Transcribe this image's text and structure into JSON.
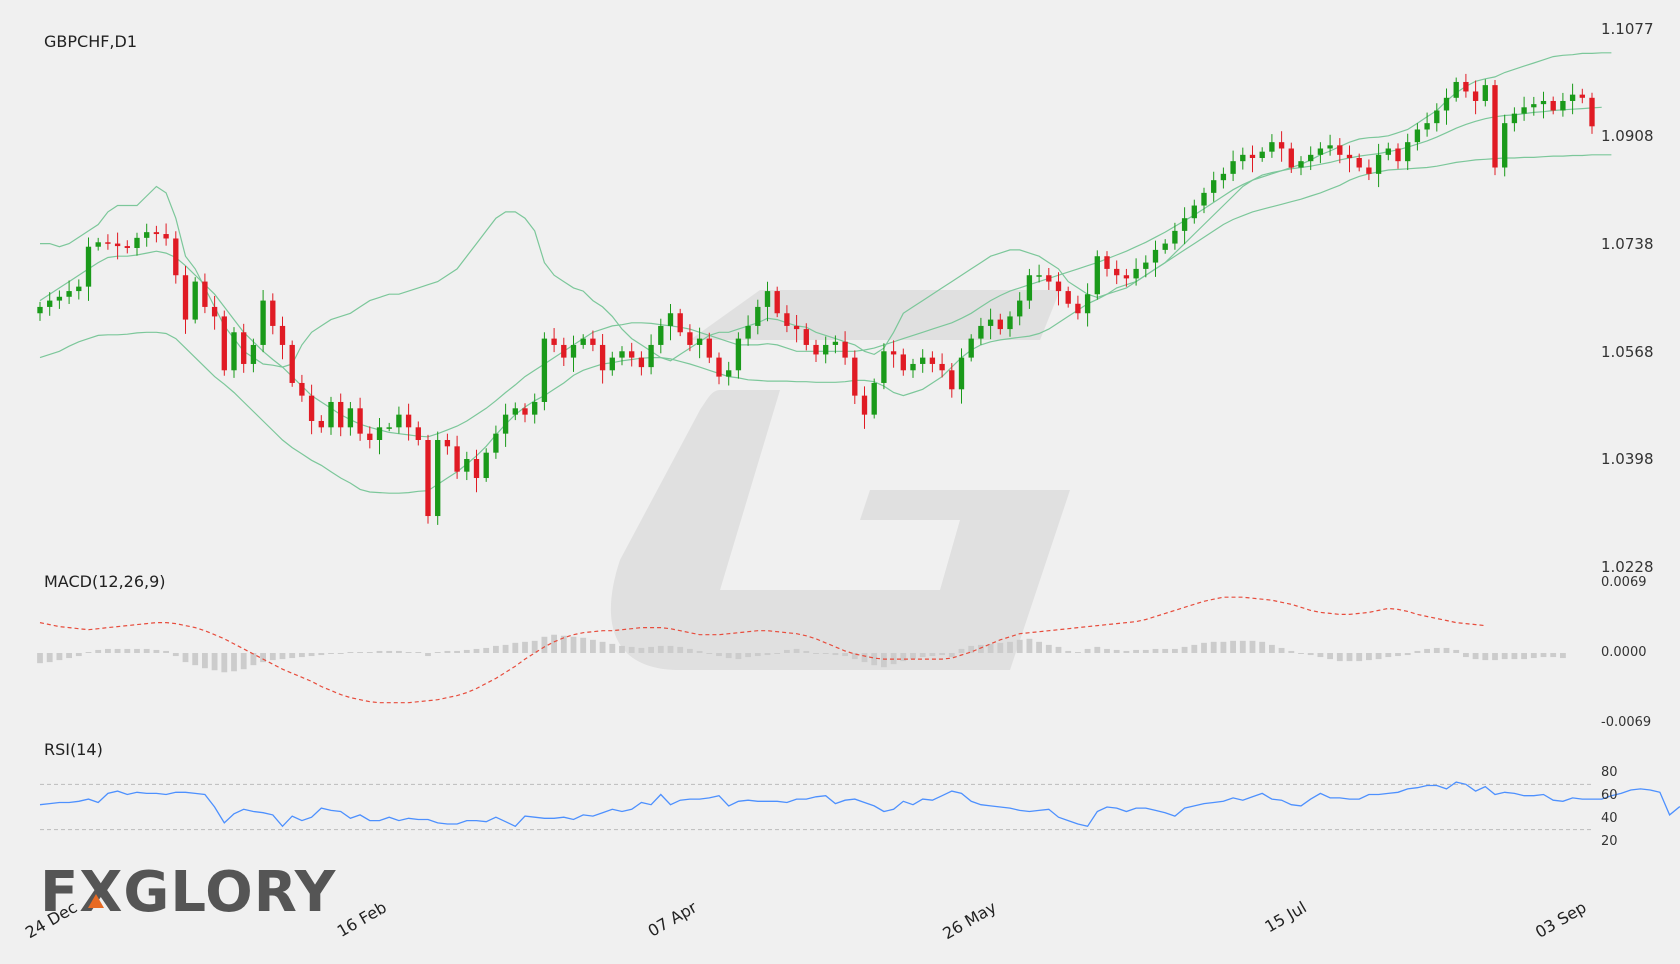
{
  "chart_data": [
    {
      "type": "candlestick",
      "title": "GBPCHF,D1",
      "symbol": "GBPCHF",
      "timeframe": "D1",
      "x_tick_labels": [
        "24 Dec",
        "16 Feb",
        "07 Apr",
        "26 May",
        "15 Jul",
        "03 Sep"
      ],
      "y_tick_labels": [
        "1.1077",
        "1.0908",
        "1.0738",
        "1.0568",
        "1.0398",
        "1.0228"
      ],
      "ylim": [
        1.0228,
        1.1077
      ],
      "overlays": [
        "Bollinger Bands"
      ],
      "up_color": "#1a9a1a",
      "down_color": "#e01b24",
      "band_color": "#7cc79a",
      "close": [
        1.064,
        1.065,
        1.0656,
        1.0665,
        1.0672,
        1.0735,
        1.0742,
        1.074,
        1.0736,
        1.0733,
        1.0749,
        1.0758,
        1.0755,
        1.0748,
        1.069,
        1.062,
        1.068,
        1.064,
        1.0625,
        1.054,
        1.06,
        1.055,
        1.058,
        1.065,
        1.061,
        1.058,
        1.052,
        1.05,
        1.046,
        1.045,
        1.049,
        1.045,
        1.048,
        1.044,
        1.043,
        1.045,
        1.045,
        1.047,
        1.045,
        1.043,
        1.031,
        1.043,
        1.042,
        1.038,
        1.04,
        1.037,
        1.041,
        1.044,
        1.047,
        1.048,
        1.047,
        1.049,
        1.059,
        1.058,
        1.056,
        1.058,
        1.059,
        1.058,
        1.054,
        1.056,
        1.057,
        1.056,
        1.0545,
        1.058,
        1.061,
        1.063,
        1.06,
        1.058,
        1.059,
        1.056,
        1.053,
        1.054,
        1.059,
        1.061,
        1.064,
        1.0665,
        1.063,
        1.061,
        1.0605,
        1.058,
        1.0565,
        1.058,
        1.0585,
        1.056,
        1.05,
        1.047,
        1.052,
        1.057,
        1.0565,
        1.054,
        1.055,
        1.056,
        1.055,
        1.054,
        1.051,
        1.056,
        1.059,
        1.061,
        1.062,
        1.0605,
        1.0625,
        1.065,
        1.069,
        1.069,
        1.068,
        1.0665,
        1.0645,
        1.063,
        1.066,
        1.072,
        1.07,
        1.069,
        1.0685,
        1.07,
        1.071,
        1.073,
        1.074,
        1.076,
        1.078,
        1.08,
        1.082,
        1.084,
        1.085,
        1.087,
        1.088,
        1.0875,
        1.0885,
        1.09,
        1.089,
        1.086,
        1.087,
        1.088,
        1.089,
        1.0895,
        1.088,
        1.0875,
        1.086,
        1.085,
        1.088,
        1.089,
        1.087,
        1.09,
        1.092,
        1.093,
        1.095,
        1.097,
        1.0995,
        1.098,
        1.0965,
        1.099,
        1.086,
        1.093,
        1.0945,
        1.0955,
        1.096,
        1.0965,
        1.095,
        1.0965,
        1.0975,
        1.097,
        1.0925
      ],
      "bollinger_upper": [
        1.074,
        1.074,
        1.0735,
        1.074,
        1.075,
        1.076,
        1.077,
        1.079,
        1.08,
        1.08,
        1.08,
        1.0815,
        1.083,
        1.082,
        1.078,
        1.072,
        1.07,
        1.067,
        1.064,
        1.061,
        1.059,
        1.057,
        1.056,
        1.055,
        1.0548,
        1.0545,
        1.055,
        1.058,
        1.06,
        1.061,
        1.062,
        1.0625,
        1.063,
        1.064,
        1.065,
        1.0655,
        1.066,
        1.066,
        1.0665,
        1.067,
        1.0675,
        1.068,
        1.069,
        1.07,
        1.072,
        1.074,
        1.076,
        1.078,
        1.079,
        1.079,
        1.078,
        1.076,
        1.071,
        1.069,
        1.068,
        1.067,
        1.0665,
        1.065,
        1.064,
        1.0625,
        1.0605,
        1.059,
        1.058,
        1.057,
        1.056,
        1.0555,
        1.0565,
        1.0575,
        1.0585,
        1.0595,
        1.06,
        1.06,
        1.0605,
        1.061,
        1.0615,
        1.0622,
        1.062,
        1.0615,
        1.061,
        1.0608,
        1.06,
        1.0595,
        1.059,
        1.0585,
        1.058,
        1.057,
        1.0565,
        1.0575,
        1.06,
        1.063,
        1.064,
        1.065,
        1.066,
        1.067,
        1.068,
        1.069,
        1.07,
        1.071,
        1.072,
        1.0725,
        1.073,
        1.073,
        1.0725,
        1.072,
        1.071,
        1.07,
        1.068,
        1.067,
        1.066,
        1.0655,
        1.066,
        1.067,
        1.0675,
        1.068,
        1.069,
        1.07,
        1.071,
        1.0725,
        1.074,
        1.0755,
        1.077,
        1.0785,
        1.08,
        1.0815,
        1.083,
        1.084,
        1.0848,
        1.0852,
        1.0855,
        1.086,
        1.0865,
        1.0872,
        1.088,
        1.0886,
        1.0893,
        1.09,
        1.0905,
        1.0907,
        1.0908,
        1.091,
        1.0915,
        1.092,
        1.093,
        1.094,
        1.095,
        1.0965,
        1.0978,
        1.0988,
        1.0996,
        1.1,
        1.1003,
        1.101,
        1.1015,
        1.102,
        1.1025,
        1.103,
        1.1035,
        1.1037,
        1.1038,
        1.104,
        1.104,
        1.1041,
        1.1041
      ],
      "bollinger_middle": [
        1.065,
        1.066,
        1.067,
        1.068,
        1.069,
        1.07,
        1.071,
        1.0718,
        1.072,
        1.072,
        1.0722,
        1.0725,
        1.0728,
        1.0725,
        1.0718,
        1.0705,
        1.069,
        1.0675,
        1.066,
        1.064,
        1.062,
        1.06,
        1.0585,
        1.057,
        1.0557,
        1.0545,
        1.053,
        1.0515,
        1.05,
        1.049,
        1.048,
        1.047,
        1.0462,
        1.0455,
        1.045,
        1.0446,
        1.0442,
        1.044,
        1.0438,
        1.0436,
        1.0435,
        1.044,
        1.0446,
        1.0452,
        1.046,
        1.047,
        1.048,
        1.0492,
        1.0505,
        1.0517,
        1.053,
        1.054,
        1.055,
        1.056,
        1.057,
        1.058,
        1.059,
        1.06,
        1.0605,
        1.061,
        1.0612,
        1.0615,
        1.0615,
        1.0614,
        1.0612,
        1.061,
        1.0608,
        1.0605,
        1.06,
        1.0595,
        1.059,
        1.0585,
        1.058,
        1.058,
        1.058,
        1.0582,
        1.058,
        1.0575,
        1.057,
        1.057,
        1.057,
        1.057,
        1.057,
        1.057,
        1.057,
        1.0572,
        1.0575,
        1.058,
        1.0585,
        1.059,
        1.0595,
        1.06,
        1.0605,
        1.061,
        1.0615,
        1.0622,
        1.063,
        1.064,
        1.065,
        1.0658,
        1.0665,
        1.067,
        1.0675,
        1.068,
        1.0685,
        1.069,
        1.0695,
        1.07,
        1.0705,
        1.071,
        1.0716,
        1.0722,
        1.0728,
        1.0735,
        1.0742,
        1.075,
        1.0758,
        1.0767,
        1.0776,
        1.0785,
        1.0795,
        1.0805,
        1.0815,
        1.0825,
        1.0833,
        1.084,
        1.0845,
        1.085,
        1.0855,
        1.0858,
        1.086,
        1.0862,
        1.0865,
        1.0868,
        1.0872,
        1.0875,
        1.0878,
        1.088,
        1.0882,
        1.0885,
        1.0888,
        1.0892,
        1.0897,
        1.0902,
        1.0908,
        1.0915,
        1.0922,
        1.0928,
        1.0933,
        1.0937,
        1.094,
        1.0942,
        1.0943,
        1.0945,
        1.0947,
        1.0948,
        1.095,
        1.0951,
        1.0952,
        1.0953,
        1.0954,
        1.0955
      ],
      "bollinger_lower": [
        1.056,
        1.0565,
        1.057,
        1.0578,
        1.0585,
        1.059,
        1.0595,
        1.0596,
        1.0596,
        1.0597,
        1.0599,
        1.06,
        1.06,
        1.0598,
        1.059,
        1.0575,
        1.056,
        1.0545,
        1.053,
        1.0518,
        1.0505,
        1.049,
        1.0475,
        1.046,
        1.0445,
        1.043,
        1.0418,
        1.0408,
        1.0398,
        1.039,
        1.038,
        1.037,
        1.0362,
        1.0352,
        1.0348,
        1.0347,
        1.0346,
        1.0346,
        1.0347,
        1.0349,
        1.035,
        1.036,
        1.037,
        1.038,
        1.0392,
        1.0405,
        1.042,
        1.0438,
        1.0455,
        1.047,
        1.0482,
        1.0492,
        1.05,
        1.051,
        1.052,
        1.0532,
        1.054,
        1.0545,
        1.055,
        1.0552,
        1.0555,
        1.0557,
        1.0559,
        1.056,
        1.056,
        1.0558,
        1.0554,
        1.055,
        1.0545,
        1.054,
        1.0535,
        1.053,
        1.0528,
        1.0525,
        1.0524,
        1.0523,
        1.0523,
        1.0523,
        1.0522,
        1.0522,
        1.0521,
        1.0521,
        1.0521,
        1.0522,
        1.0524,
        1.0524,
        1.0522,
        1.0515,
        1.0505,
        1.05,
        1.0505,
        1.051,
        1.052,
        1.053,
        1.0545,
        1.056,
        1.0572,
        1.058,
        1.0585,
        1.0588,
        1.059,
        1.0592,
        1.0594,
        1.0598,
        1.0605,
        1.0615,
        1.0625,
        1.0635,
        1.0645,
        1.0652,
        1.066,
        1.0665,
        1.067,
        1.068,
        1.069,
        1.07,
        1.071,
        1.072,
        1.073,
        1.074,
        1.075,
        1.076,
        1.077,
        1.0778,
        1.0784,
        1.079,
        1.0794,
        1.0798,
        1.0802,
        1.0806,
        1.081,
        1.0815,
        1.082,
        1.0826,
        1.0832,
        1.084,
        1.0846,
        1.085,
        1.0853,
        1.0856,
        1.0857,
        1.0858,
        1.0859,
        1.086,
        1.0862,
        1.0865,
        1.0868,
        1.087,
        1.0872,
        1.0873,
        1.0874,
        1.0875,
        1.0875,
        1.0876,
        1.0876,
        1.0877,
        1.0878,
        1.0878,
        1.0879,
        1.0879,
        1.088,
        1.088,
        1.088
      ]
    },
    {
      "type": "line",
      "title": "MACD(12,26,9)",
      "y_tick_labels": [
        "0.0069",
        "0.0000",
        "-0.0069"
      ],
      "ylim": [
        -0.0069,
        0.0069
      ],
      "histogram_color": "#cccccc",
      "signal_color": "#e74c3c",
      "signal": [
        0.003,
        0.0028,
        0.0026,
        0.0025,
        0.0024,
        0.0023,
        0.0024,
        0.0025,
        0.0026,
        0.0027,
        0.0028,
        0.0029,
        0.003,
        0.003,
        0.0029,
        0.0027,
        0.0025,
        0.0022,
        0.0018,
        0.0014,
        0.0009,
        0.0004,
        -0.0001,
        -0.0006,
        -0.0011,
        -0.0016,
        -0.002,
        -0.0024,
        -0.0028,
        -0.0033,
        -0.0037,
        -0.0041,
        -0.0044,
        -0.0046,
        -0.0048,
        -0.0049,
        -0.0049,
        -0.0049,
        -0.0049,
        -0.0048,
        -0.0047,
        -0.0046,
        -0.0044,
        -0.0042,
        -0.0039,
        -0.0035,
        -0.003,
        -0.0025,
        -0.0019,
        -0.0013,
        -0.0006,
        0.0,
        0.0006,
        0.0011,
        0.0015,
        0.0018,
        0.002,
        0.0021,
        0.0022,
        0.0022,
        0.0023,
        0.0024,
        0.0025,
        0.0025,
        0.0025,
        0.0024,
        0.0022,
        0.002,
        0.0018,
        0.0018,
        0.0018,
        0.0019,
        0.002,
        0.0021,
        0.0022,
        0.0022,
        0.0021,
        0.002,
        0.0019,
        0.0017,
        0.0014,
        0.001,
        0.0006,
        0.0002,
        -0.0001,
        -0.0003,
        -0.0005,
        -0.0006,
        -0.0006,
        -0.0006,
        -0.0006,
        -0.0006,
        -0.0006,
        -0.0006,
        -0.0005,
        -0.0002,
        0.0001,
        0.0005,
        0.0009,
        0.0013,
        0.0016,
        0.0019,
        0.002,
        0.0021,
        0.0022,
        0.0023,
        0.0024,
        0.0025,
        0.0026,
        0.0027,
        0.0028,
        0.0029,
        0.003,
        0.0031,
        0.0033,
        0.0036,
        0.0039,
        0.0042,
        0.0045,
        0.0048,
        0.0051,
        0.0053,
        0.0055,
        0.0055,
        0.0055,
        0.0054,
        0.0053,
        0.0052,
        0.005,
        0.0048,
        0.0045,
        0.0042,
        0.004,
        0.0039,
        0.0038,
        0.0038,
        0.0039,
        0.004,
        0.0042,
        0.0044,
        0.0043,
        0.0041,
        0.0038,
        0.0036,
        0.0034,
        0.0032,
        0.003,
        0.0029,
        0.0028,
        0.0027
      ],
      "histogram": [
        -0.001,
        -0.0009,
        -0.0007,
        -0.0005,
        -0.0003,
        0.0001,
        0.0003,
        0.0004,
        0.0004,
        0.0004,
        0.0004,
        0.0004,
        0.0003,
        0.0002,
        -0.0003,
        -0.0009,
        -0.0012,
        -0.0015,
        -0.0017,
        -0.0019,
        -0.0018,
        -0.0016,
        -0.0012,
        -0.0009,
        -0.0007,
        -0.0006,
        -0.0005,
        -0.0004,
        -0.0003,
        -0.0002,
        -0.0001,
        0.0,
        0.0001,
        0.0001,
        0.0001,
        0.0002,
        0.0002,
        0.0002,
        0.0001,
        0.0001,
        -0.0003,
        0.0001,
        0.0002,
        0.0002,
        0.0003,
        0.0004,
        0.0005,
        0.0007,
        0.0008,
        0.001,
        0.0011,
        0.0012,
        0.0016,
        0.0018,
        0.0017,
        0.0016,
        0.0015,
        0.0013,
        0.0011,
        0.0009,
        0.0007,
        0.0006,
        0.0005,
        0.0006,
        0.0007,
        0.0007,
        0.0006,
        0.0004,
        0.0002,
        0.0,
        -0.0003,
        -0.0005,
        -0.0006,
        -0.0004,
        -0.0003,
        -0.0002,
        0.0,
        0.0003,
        0.0004,
        0.0002,
        0.0,
        -0.0001,
        -0.0002,
        -0.0003,
        -0.0006,
        -0.0009,
        -0.0012,
        -0.0014,
        -0.0011,
        -0.0008,
        -0.0006,
        -0.0004,
        -0.0003,
        -0.0002,
        -0.0004,
        0.0004,
        0.0007,
        0.0008,
        0.0009,
        0.001,
        0.0011,
        0.0013,
        0.0014,
        0.0011,
        0.0008,
        0.0006,
        0.0002,
        0.0001,
        0.0004,
        0.0006,
        0.0004,
        0.0003,
        0.0002,
        0.0003,
        0.0003,
        0.0004,
        0.0004,
        0.0004,
        0.0006,
        0.0008,
        0.001,
        0.0011,
        0.0011,
        0.0012,
        0.0012,
        0.0012,
        0.0011,
        0.0008,
        0.0005,
        0.0002,
        0.0,
        -0.0002,
        -0.0004,
        -0.0006,
        -0.0008,
        -0.0008,
        -0.0008,
        -0.0007,
        -0.0006,
        -0.0004,
        -0.0003,
        -0.0002,
        0.0002,
        0.0004,
        0.0005,
        0.0005,
        0.0003,
        -0.0004,
        -0.0006,
        -0.0007,
        -0.0007,
        -0.0006,
        -0.0006,
        -0.0006,
        -0.0005,
        -0.0004,
        -0.0004,
        -0.0005
      ]
    },
    {
      "type": "line",
      "title": "RSI(14)",
      "y_tick_labels": [
        "80",
        "60",
        "40",
        "20"
      ],
      "ylim": [
        20,
        80
      ],
      "reference_levels": [
        70,
        30
      ],
      "line_color": "#4d90fe",
      "values": [
        52,
        53,
        54,
        54,
        55,
        57,
        54,
        62,
        64,
        61,
        63,
        62,
        62,
        61,
        63,
        63,
        62,
        61,
        50,
        36,
        44,
        48,
        46,
        45,
        43,
        33,
        42,
        38,
        41,
        49,
        47,
        46,
        40,
        43,
        38,
        38,
        41,
        38,
        40,
        39,
        39,
        36,
        35,
        35,
        38,
        38,
        37,
        41,
        37,
        33,
        42,
        41,
        40,
        40,
        41,
        39,
        43,
        42,
        45,
        48,
        46,
        48,
        54,
        52,
        61,
        52,
        56,
        57,
        57,
        58,
        60,
        51,
        55,
        56,
        55,
        55,
        55,
        54,
        57,
        57,
        59,
        60,
        53,
        56,
        57,
        54,
        51,
        46,
        48,
        55,
        52,
        57,
        56,
        60,
        64,
        62,
        55,
        52,
        51,
        50,
        49,
        47,
        46,
        47,
        48,
        41,
        38,
        35,
        33,
        46,
        50,
        49,
        46,
        49,
        49,
        47,
        45,
        42,
        49,
        51,
        53,
        54,
        55,
        58,
        56,
        59,
        62,
        57,
        56,
        52,
        51,
        57,
        62,
        58,
        58,
        57,
        57,
        61,
        61,
        62,
        63,
        66,
        67,
        69,
        69,
        66,
        72,
        70,
        64,
        68,
        61,
        63,
        62,
        60,
        60,
        61,
        56,
        55,
        58,
        57,
        57,
        57,
        60,
        62,
        65,
        66,
        65,
        63,
        43,
        50,
        53,
        52,
        51,
        55,
        55,
        54,
        57,
        57,
        51
      ]
    }
  ],
  "logo": {
    "text": "FXGLORY"
  }
}
